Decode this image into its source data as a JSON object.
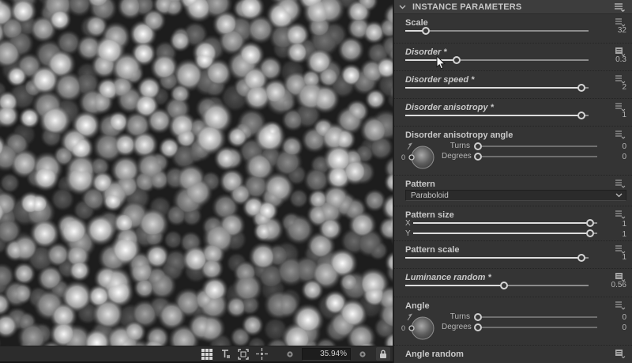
{
  "viewport": {
    "toolbar": {
      "zoom_value": "35.94%"
    }
  },
  "panel": {
    "header": {
      "title": "INSTANCE PARAMETERS"
    },
    "params": {
      "scale": {
        "label": "Scale",
        "value": "32"
      },
      "disorder": {
        "label": "Disorder *",
        "value": "0.3"
      },
      "disorder_speed": {
        "label": "Disorder speed *",
        "value": "2"
      },
      "disorder_anisotropy": {
        "label": "Disorder anisotropy *",
        "value": "1"
      },
      "disorder_anisotropy_angle": {
        "label": "Disorder anisotropy angle",
        "zero": "0",
        "turns_label": "Turns",
        "degrees_label": "Degrees",
        "turns_value": "0",
        "degrees_value": "0"
      },
      "pattern": {
        "label": "Pattern",
        "value": "Paraboloid"
      },
      "pattern_size": {
        "label": "Pattern size",
        "x_label": "X",
        "y_label": "Y",
        "x_value": "1",
        "y_value": "1"
      },
      "pattern_scale": {
        "label": "Pattern scale",
        "value": "1"
      },
      "luminance_random": {
        "label": "Luminance random *",
        "value": "0.56"
      },
      "angle": {
        "label": "Angle",
        "zero": "0",
        "turns_label": "Turns",
        "degrees_label": "Degrees",
        "turns_value": "0",
        "degrees_value": "0"
      },
      "angle_random": {
        "label": "Angle random"
      }
    }
  }
}
